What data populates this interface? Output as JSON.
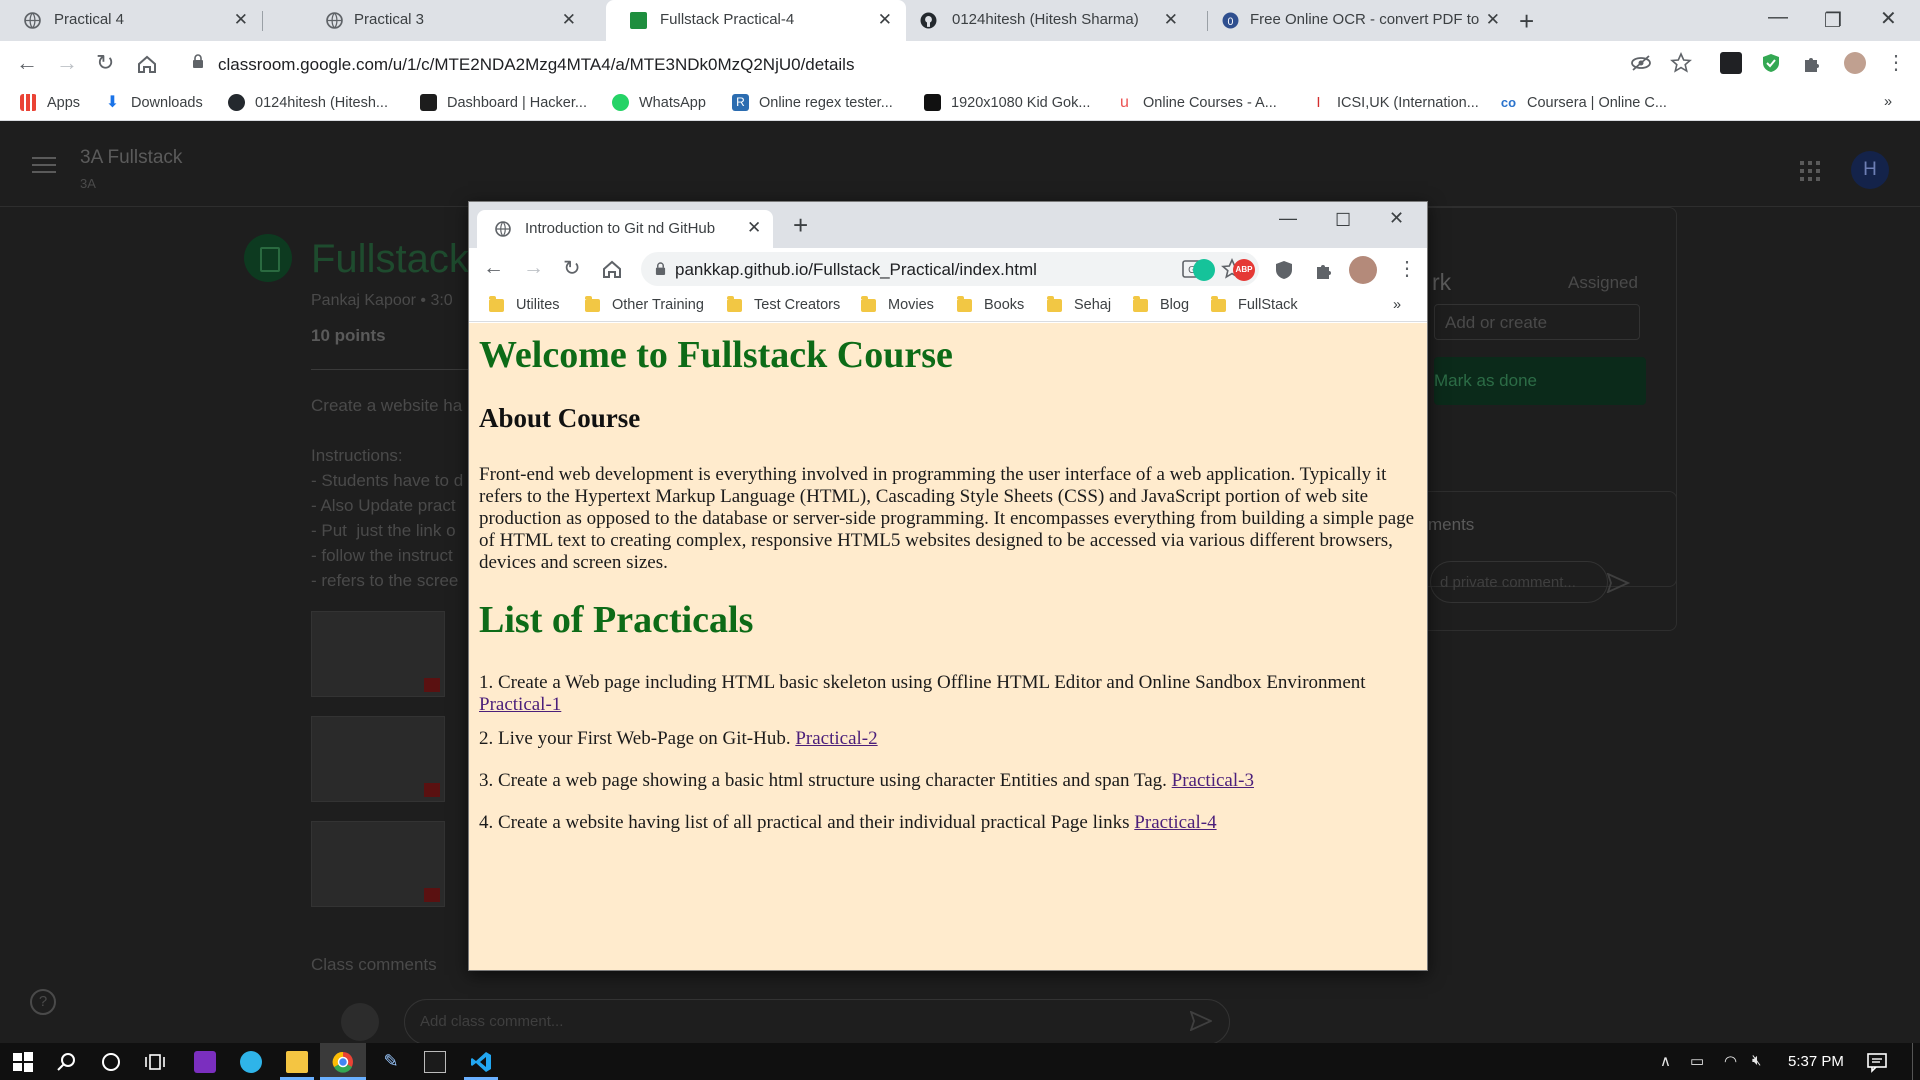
{
  "chrome": {
    "tabs": [
      {
        "label": "Practical 4",
        "active": false
      },
      {
        "label": "Practical 3",
        "active": false
      },
      {
        "label": "Fullstack Practical-4",
        "active": true
      },
      {
        "label": "0124hitesh (Hitesh Sharma)",
        "active": false
      },
      {
        "label": "Free Online OCR - convert PDF to",
        "active": false
      }
    ],
    "url": "classroom.google.com/u/1/c/MTE2NDA2Mzg4MTA4/a/MTE3NDk0MzQ2NjU0/details",
    "bookmarks": [
      {
        "label": "Apps",
        "icon": "apps-grid-icon"
      },
      {
        "label": "Downloads",
        "icon": "download-icon"
      },
      {
        "label": "0124hitesh (Hitesh...",
        "icon": "github-icon"
      },
      {
        "label": "Dashboard | Hacker...",
        "icon": "hackerrank-icon"
      },
      {
        "label": "WhatsApp",
        "icon": "whatsapp-icon"
      },
      {
        "label": "Online regex tester...",
        "icon": "regex-icon"
      },
      {
        "label": "1920x1080 Kid Gok...",
        "icon": "wallpaper-icon"
      },
      {
        "label": "Online Courses - A...",
        "icon": "udemy-icon"
      },
      {
        "label": "ICSI,UK (Internation...",
        "icon": "icsi-icon"
      },
      {
        "label": "Coursera | Online C...",
        "icon": "coursera-icon"
      }
    ],
    "more_bookmarks": "»"
  },
  "classroom": {
    "class_name": "3A Fullstack",
    "class_section": "3A",
    "avatar_initial": "H",
    "assignment_title": "Fullstack",
    "assignment_meta": "Pankaj Kapoor • 3:0",
    "points": "10 points",
    "description_lines": "Create a website ha\n\nInstructions:\n- Students have to d\n- Also Update pract\n- Put  just the link o\n- follow the instruct\n- refers to the scree",
    "class_comments": "Class comments",
    "comment_placeholder": "Add class comment...",
    "your_work_title": "rk",
    "your_work_status": "Assigned",
    "add_or_create": "Add or create",
    "mark_as_done": "Mark as done",
    "private_comments_title": "ments",
    "private_comment_placeholder": "d private comment..."
  },
  "popup": {
    "tab_title": "Introduction to Git nd GitHub",
    "url": "pankkap.github.io/Fullstack_Practical/index.html",
    "bookmarks": [
      "Utilites",
      "Other Training",
      "Test Creators",
      "Movies",
      "Books",
      "Sehaj",
      "Blog",
      "FullStack"
    ],
    "more_bookmarks": "»",
    "page": {
      "heading": "Welcome to Fullstack Course",
      "about_heading": "About Course",
      "about_text": "Front-end web development is everything involved in programming the user interface of a web application. Typically it refers to the Hypertext Markup Language (HTML), Cascading Style Sheets (CSS) and JavaScript portion of web site production as opposed to the database or server-side programming. It encompasses everything from building a simple page of HTML text to creating complex, responsive HTML5 websites designed to be accessed via various different browsers, devices and screen sizes.",
      "list_heading": "List of Practicals",
      "practicals": [
        {
          "text": "1. Create a Web page including HTML basic skeleton using Offline HTML Editor and Online Sandbox Environment",
          "link": "Practical-1"
        },
        {
          "text": "2. Live your First Web-Page on Git-Hub.",
          "link": "Practical-2"
        },
        {
          "text": "3. Create a web page showing a basic html structure using character Entities and span Tag.",
          "link": "Practical-3"
        },
        {
          "text": "4. Create a website having list of all practical and their individual practical Page links",
          "link": "Practical-4"
        }
      ]
    }
  },
  "taskbar": {
    "clock": "5:37 PM"
  },
  "colors": {
    "page_bg": "#ffebcd",
    "heading_green": "#0d6b17",
    "link_purple": "#4b1f7a",
    "classroom_dim": "#1e1e1e"
  }
}
